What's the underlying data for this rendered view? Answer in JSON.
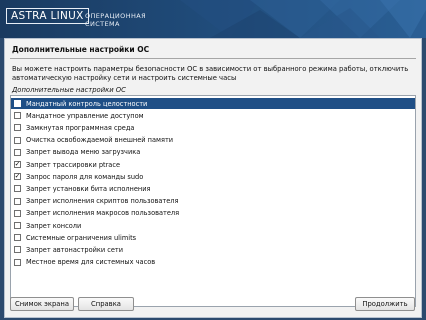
{
  "brand": {
    "name": "ASTRA LINUX",
    "subtitle_line1": "ОПЕРАЦИОННАЯ",
    "subtitle_line2": "СИСТЕМА"
  },
  "page": {
    "title": "Дополнительные настройки ОС",
    "description_line1": "Вы можете настроить параметры безопасности ОС в зависимости от выбранного режима работы, отключить",
    "description_line2": "автоматическую настройку сети и настроить системные часы",
    "group_label": "Дополнительные настройки ОС"
  },
  "options": [
    {
      "label": "Мандатный контроль целостности",
      "checked": false,
      "selected": true
    },
    {
      "label": "Мандатное управление доступом",
      "checked": false,
      "selected": false
    },
    {
      "label": "Замкнутая программная среда",
      "checked": false,
      "selected": false
    },
    {
      "label": "Очистка освобождаемой внешней памяти",
      "checked": false,
      "selected": false
    },
    {
      "label": "Запрет вывода меню загрузчика",
      "checked": false,
      "selected": false
    },
    {
      "label": "Запрет трассировки ptrace",
      "checked": true,
      "selected": false
    },
    {
      "label": "Запрос пароля для команды sudo",
      "checked": true,
      "selected": false
    },
    {
      "label": "Запрет установки бита исполнения",
      "checked": false,
      "selected": false
    },
    {
      "label": "Запрет исполнения скриптов пользователя",
      "checked": false,
      "selected": false
    },
    {
      "label": "Запрет исполнения макросов пользователя",
      "checked": false,
      "selected": false
    },
    {
      "label": "Запрет консоли",
      "checked": false,
      "selected": false
    },
    {
      "label": "Системные ограничения ulimits",
      "checked": false,
      "selected": false
    },
    {
      "label": "Запрет автонастройки сети",
      "checked": false,
      "selected": false
    },
    {
      "label": "Местное время для системных часов",
      "checked": false,
      "selected": false
    }
  ],
  "buttons": {
    "screenshot": "Снимок экрана",
    "help": "Справка",
    "continue": "Продолжить"
  },
  "colors": {
    "banner": "#1f4a78",
    "selection": "#1f4f86",
    "window_bg": "#f2f2f2"
  }
}
